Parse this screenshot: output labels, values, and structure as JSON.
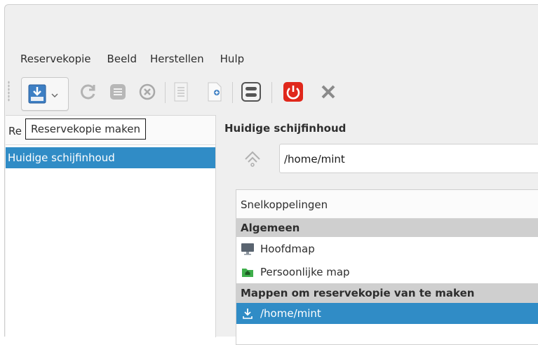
{
  "menu": {
    "items": [
      "Reservekopie",
      "Beeld",
      "Herstellen",
      "Hulp"
    ]
  },
  "toolbar": {
    "buttons": [
      {
        "name": "backup-now",
        "icon": "backup-drive-icon"
      },
      {
        "name": "refresh",
        "icon": "refresh-icon"
      },
      {
        "name": "log",
        "icon": "list-icon"
      },
      {
        "name": "cancel",
        "icon": "cancel-circle-icon"
      },
      {
        "name": "document",
        "icon": "document-icon"
      },
      {
        "name": "new-document",
        "icon": "new-document-icon"
      },
      {
        "name": "settings",
        "icon": "toggle-settings-icon"
      },
      {
        "name": "shutdown",
        "icon": "power-icon"
      },
      {
        "name": "quit",
        "icon": "close-x-icon"
      }
    ],
    "tooltip": "Reservekopie maken"
  },
  "sidebar": {
    "header": "Re",
    "items": [
      {
        "label": "Huidige schijfinhoud",
        "selected": true
      }
    ]
  },
  "main": {
    "title": "Huidige schijfinhoud",
    "path": "/home/mint",
    "places": {
      "header": "Snelkoppelingen",
      "groups": [
        {
          "label": "Algemeen",
          "items": [
            {
              "label": "Hoofdmap",
              "icon": "monitor-icon"
            },
            {
              "label": "Persoonlijke map",
              "icon": "home-folder-icon"
            }
          ]
        },
        {
          "label": "Mappen om reservekopie van te maken",
          "items": [
            {
              "label": "/home/mint",
              "icon": "download-folder-icon",
              "selected": true
            }
          ]
        }
      ]
    }
  },
  "colors": {
    "accent": "#308cc6",
    "power": "#e0271b",
    "background": "#efefef"
  }
}
